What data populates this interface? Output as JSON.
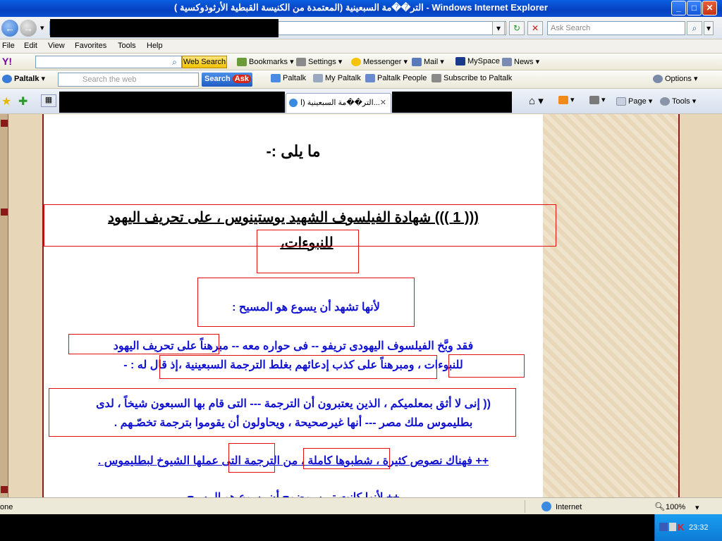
{
  "window": {
    "title": "التر��مة السبعينية (المعتمدة من الكنيسة القبطية الأرثوذوكسية ) - Windows Internet Explorer",
    "minimize": "_",
    "maximize": "□",
    "close": "✕"
  },
  "nav": {
    "back": "←",
    "forward": "→",
    "dropdown": "▾",
    "refresh": "↻",
    "stop": "✕",
    "search_placeholder": "Ask Search",
    "search_go": "⌕"
  },
  "menu": [
    "File",
    "Edit",
    "View",
    "Favorites",
    "Tools",
    "Help"
  ],
  "yahoo_toolbar": {
    "logo": "Y!",
    "web_search": "Web Search",
    "items": [
      "Bookmarks",
      "Settings",
      "Messenger",
      "Mail",
      "MySpace",
      "News"
    ]
  },
  "paltalk_toolbar": {
    "label": "Paltalk",
    "search_placeholder": "Search the web",
    "search_button": "Search",
    "ask_badge": "Ask",
    "items": [
      "Paltalk",
      "My Paltalk",
      "Paltalk People",
      "Subscribe to Paltalk"
    ],
    "options": "Options"
  },
  "tabs": {
    "active_label": "التر��مة السبعينية (ا...",
    "tools": [
      "Page",
      "Tools"
    ]
  },
  "page": {
    "line_top": "ما يلى :-",
    "heading_line1": "((( 1 ))) شهادة الفيلسوف الشهيد يوستينوس ، على تحريف اليهود",
    "heading_line2": "للنبوءات،",
    "sub": "لأنها تشهد أن يسوع هو المسيح :",
    "p1_line1": "فقد وبَّخ الفيلسوف اليهودى تريفو -- فى حواره معه -- مبرهناً على تحريف اليهود",
    "p1_line2": "للنبوءات ، ومبرهناً على كذب إدعائهم بغلط الترجمة السبعينية ،إذ قال له : -",
    "p2_line1": "(( إنى لا أثق بمعلميكم ، الذين يعتبرون أن الترجمة --- التى قام بها السبعون شيخاً ، لدى",
    "p2_line2": "بطليموس ملك مصر --- أنها غيرصحيحة ، ويحاولون أن يقوموا بترجمة تخصّـهم .",
    "p3": "++ فهناك نصوص كثيرة ، شطبوها كاملة ، من الترجمة التى عملها الشيوخ لبطليموس .",
    "p4_partial": "++ لأنها كانت تبين بوضوح أن يسوع هو المسيح"
  },
  "status": {
    "left": "one",
    "zone": "Internet",
    "zoom": "100%"
  },
  "tray": {
    "clock": "23:32"
  }
}
